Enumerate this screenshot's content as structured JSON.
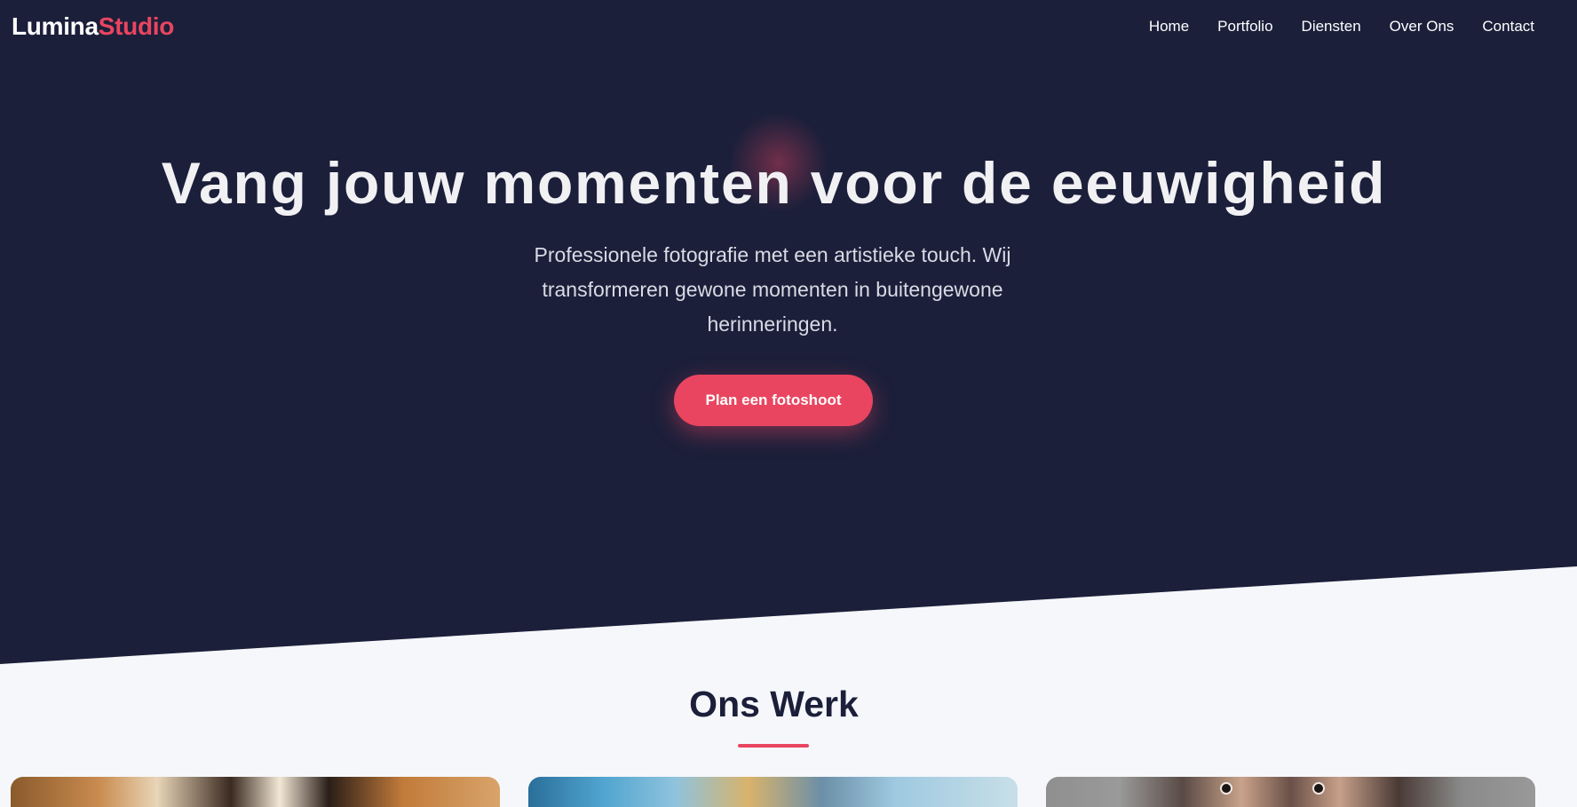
{
  "brand": {
    "name_part1": "Lumina",
    "name_part2": "Studio",
    "accent_color": "#e94560"
  },
  "nav": {
    "items": [
      {
        "label": "Home"
      },
      {
        "label": "Portfolio"
      },
      {
        "label": "Diensten"
      },
      {
        "label": "Over Ons"
      },
      {
        "label": "Contact"
      }
    ]
  },
  "hero": {
    "title": "Vang jouw momenten voor de eeuwigheid",
    "subtitle": "Professionele fotografie met een artistieke touch. Wij transformeren gewone momenten in buitengewone herinneringen.",
    "cta_label": "Plan een fotoshoot",
    "background_color": "#1b1f3a"
  },
  "work": {
    "title": "Ons Werk",
    "cards": [
      {
        "name": "portfolio-card-1"
      },
      {
        "name": "portfolio-card-2"
      },
      {
        "name": "portfolio-card-3"
      }
    ]
  }
}
